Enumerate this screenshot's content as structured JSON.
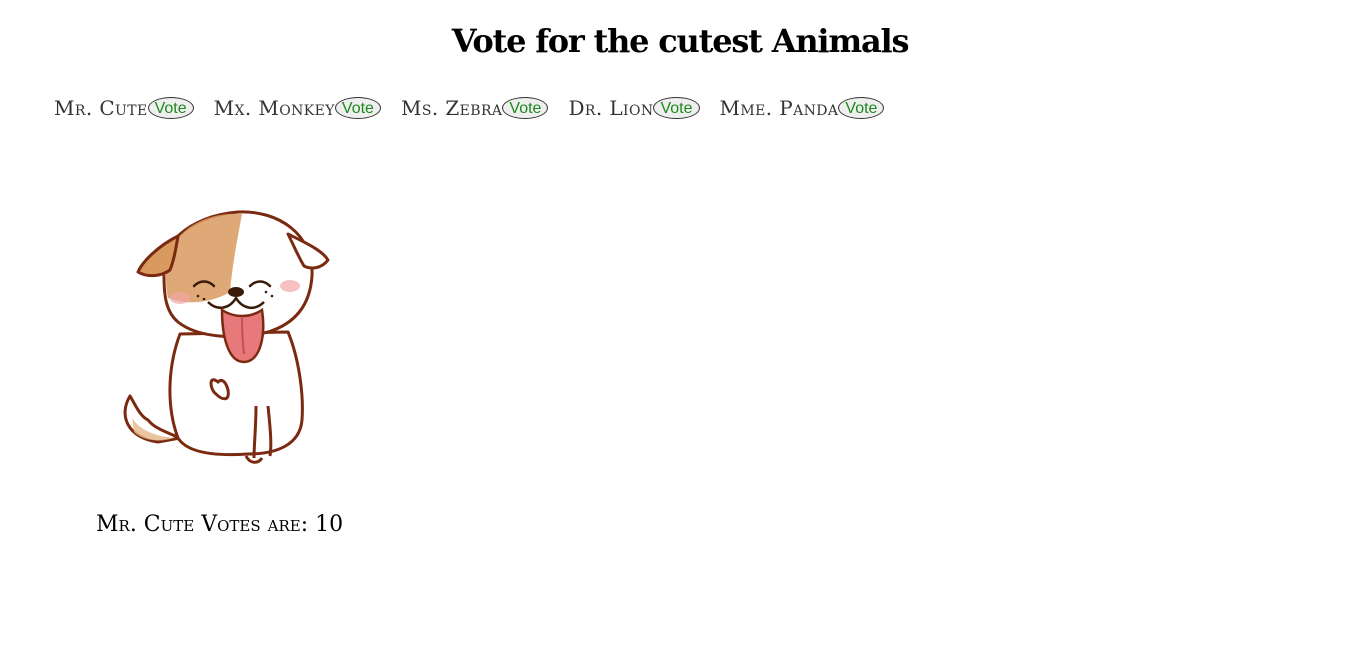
{
  "page": {
    "title": "Vote for the cutest Animals"
  },
  "animals": [
    {
      "name": "Mr. Cute",
      "button_label": "Vote"
    },
    {
      "name": "Mx. Monkey",
      "button_label": "Vote"
    },
    {
      "name": "Ms. Zebra",
      "button_label": "Vote"
    },
    {
      "name": "Dr. Lion",
      "button_label": "Vote"
    },
    {
      "name": "Mme. Panda",
      "button_label": "Vote"
    }
  ],
  "selected": {
    "image_icon": "puppy-illustration",
    "votes_text": "Mr. Cute Votes are: 10"
  },
  "colors": {
    "vote_text": "#1e8a1e",
    "button_bg": "#efefef",
    "puppy_outline": "#7a2a10",
    "puppy_patch": "#d89a5e",
    "tongue": "#e8797a"
  }
}
